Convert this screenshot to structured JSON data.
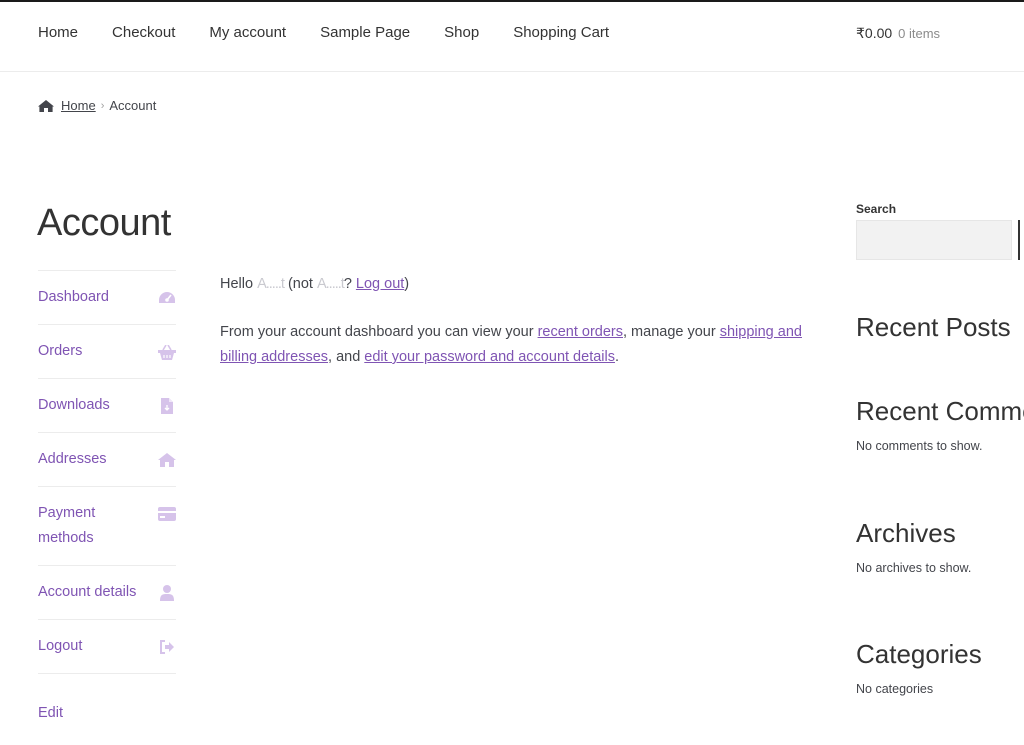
{
  "nav": {
    "items": [
      "Home",
      "Checkout",
      "My account",
      "Sample Page",
      "Shop",
      "Shopping Cart"
    ]
  },
  "cart": {
    "amount": "₹0.00",
    "count": "0 items"
  },
  "breadcrumb": {
    "home": "Home",
    "separator": "›",
    "current": "Account"
  },
  "page": {
    "title": "Account"
  },
  "account_nav": [
    {
      "label": "Dashboard",
      "icon": "dashboard-icon"
    },
    {
      "label": "Orders",
      "icon": "basket-icon"
    },
    {
      "label": "Downloads",
      "icon": "file-icon"
    },
    {
      "label": "Addresses",
      "icon": "home-icon"
    },
    {
      "label": "Payment methods",
      "icon": "credit-card-icon"
    },
    {
      "label": "Account details",
      "icon": "user-icon"
    },
    {
      "label": "Logout",
      "icon": "sign-out-icon"
    },
    {
      "label": "Edit"
    }
  ],
  "greeting": {
    "hello": "Hello ",
    "username": "A.....t",
    "not_prefix": " (not ",
    "not_username": "A.....t",
    "question": "? ",
    "logout_link": "Log out",
    "close": ")"
  },
  "dashboard_text": {
    "part1": "From your account dashboard you can view your ",
    "recent_orders": "recent orders",
    "part2": ", manage your ",
    "addresses": "shipping and billing addresses",
    "part3": ", and ",
    "account_details": "edit your password and account details",
    "part4": "."
  },
  "sidebar": {
    "search_label": "Search",
    "search_value": "",
    "recent_posts": {
      "title": "Recent Posts"
    },
    "recent_comments": {
      "title": "Recent Comments",
      "text": "No comments to show."
    },
    "archives": {
      "title": "Archives",
      "text": "No archives to show."
    },
    "categories": {
      "title": "Categories",
      "text": "No categories"
    }
  },
  "colors": {
    "accent": "#7f54b3",
    "icon": "#d6c3ea",
    "text": "#43454b"
  }
}
